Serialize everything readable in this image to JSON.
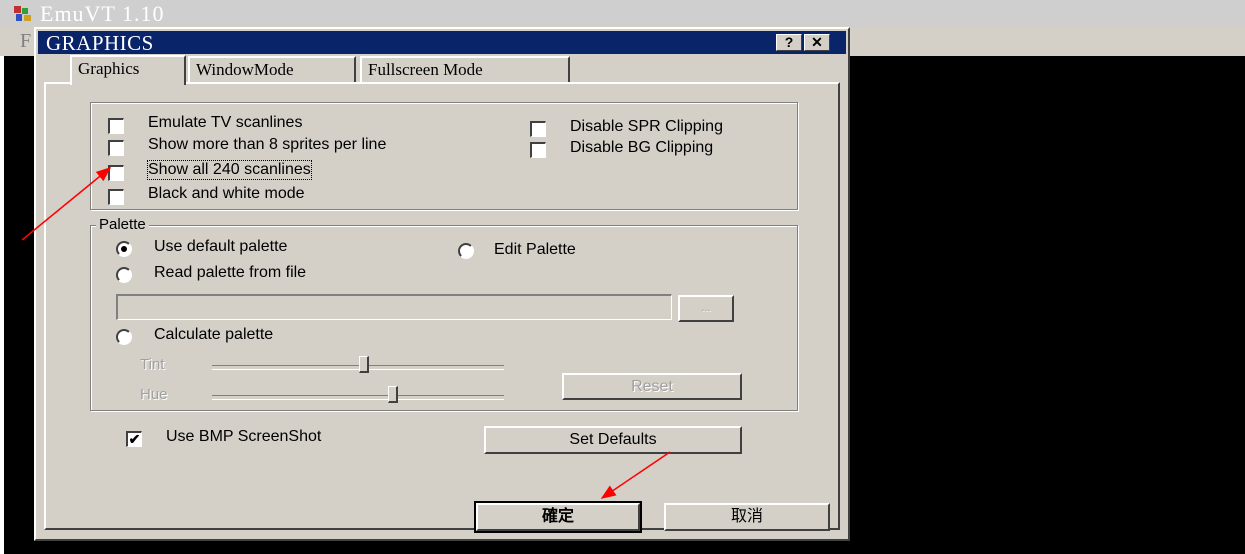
{
  "app": {
    "title": "EmuVT 1.10",
    "menu_fragment": "F"
  },
  "dialog": {
    "title": "GRAPHICS",
    "help_button": "?",
    "close_button": "✕",
    "tabs": [
      {
        "label": "Graphics",
        "active": true
      },
      {
        "label": "WindowMode",
        "active": false
      },
      {
        "label": "Fullscreen Mode",
        "active": false
      }
    ],
    "options": {
      "emulate_tv_scanlines": {
        "label": "Emulate TV scanlines",
        "checked": false
      },
      "show_more_sprites": {
        "label": "Show more than 8 sprites per line",
        "checked": false
      },
      "show_all_scanlines": {
        "label": "Show all 240 scanlines",
        "checked": false
      },
      "black_and_white": {
        "label": "Black and white mode",
        "checked": false
      },
      "disable_spr_clipping": {
        "label": "Disable SPR Clipping",
        "checked": false
      },
      "disable_bg_clipping": {
        "label": "Disable BG Clipping",
        "checked": false
      }
    },
    "palette": {
      "group_label": "Palette",
      "use_default": {
        "label": "Use default palette",
        "selected": true
      },
      "edit_palette": {
        "label": "Edit Palette",
        "selected": false
      },
      "read_from_file": {
        "label": "Read palette from file",
        "selected": false
      },
      "file_path": "",
      "browse_label": "...",
      "calculate": {
        "label": "Calculate palette",
        "selected": false
      },
      "tint_label": "Tint",
      "tint_value": 0.52,
      "hue_label": "Hue",
      "hue_value": 0.62,
      "reset_label": "Reset"
    },
    "bmp_screenshot": {
      "label": "Use BMP ScreenShot",
      "checked": true
    },
    "set_defaults_label": "Set Defaults",
    "ok_label": "確定",
    "cancel_label": "取消"
  },
  "colors": {
    "dialog_face": "#d4d0c8",
    "title_bar": "#0a246a",
    "annotation_arrow": "#ff0000"
  }
}
